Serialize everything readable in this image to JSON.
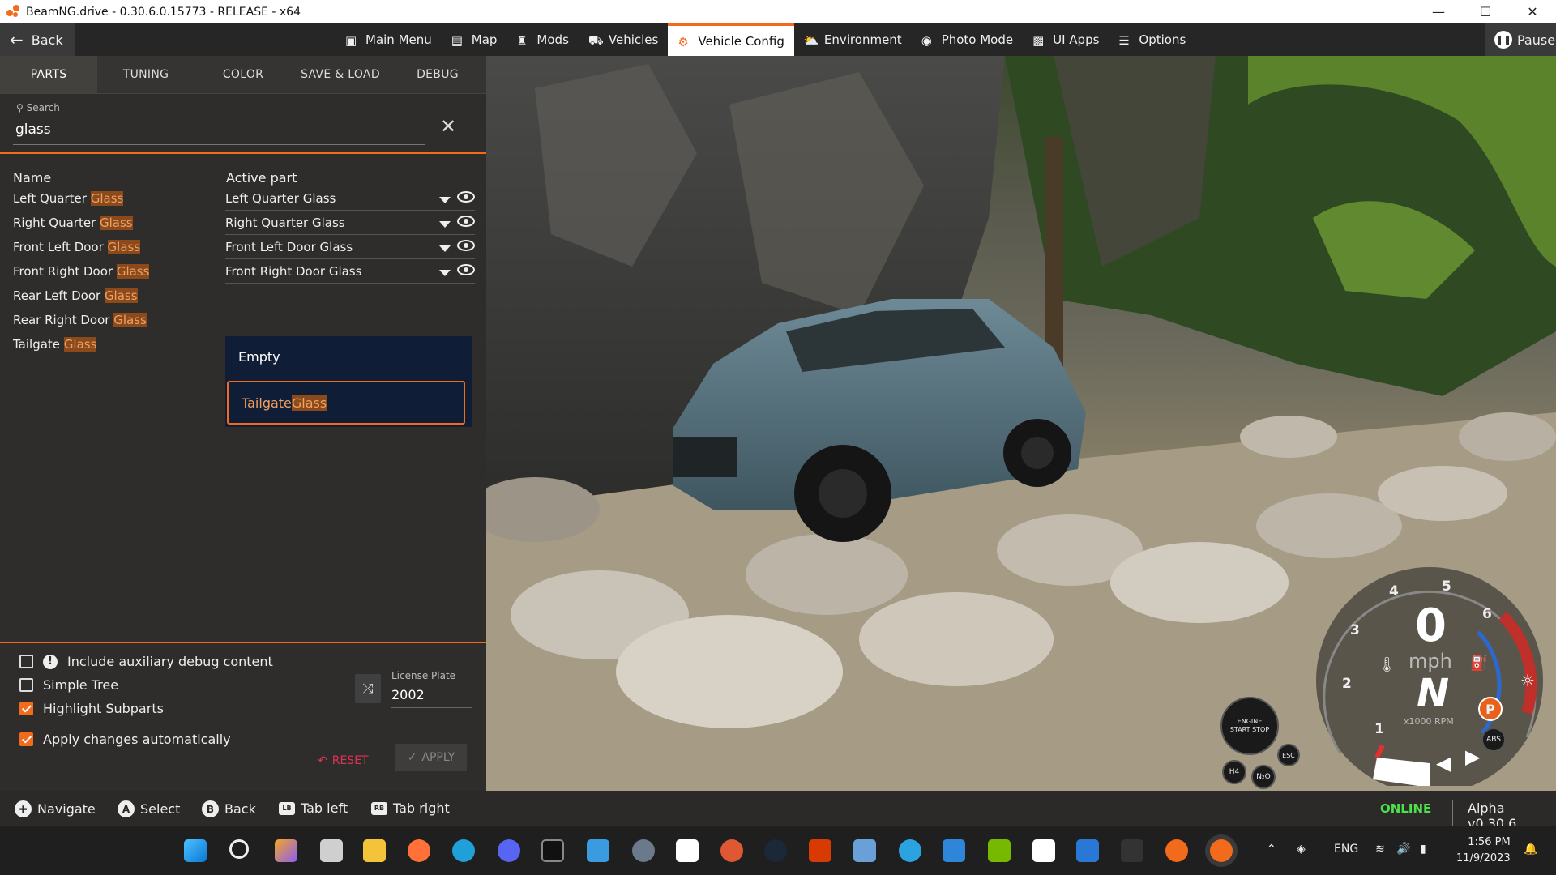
{
  "window": {
    "title": "BeamNG.drive - 0.30.6.0.15773 - RELEASE - x64"
  },
  "topbar": {
    "back_label": "Back",
    "menu": [
      {
        "label": "Main Menu",
        "icon": "main-menu-icon"
      },
      {
        "label": "Map",
        "icon": "map-icon"
      },
      {
        "label": "Mods",
        "icon": "puzzle-icon"
      },
      {
        "label": "Vehicles",
        "icon": "car-icon"
      },
      {
        "label": "Vehicle Config",
        "icon": "engine-icon",
        "active": true
      },
      {
        "label": "Environment",
        "icon": "weather-icon"
      },
      {
        "label": "Photo Mode",
        "icon": "camera-icon"
      },
      {
        "label": "UI Apps",
        "icon": "ui-apps-icon"
      },
      {
        "label": "Options",
        "icon": "sliders-icon"
      }
    ],
    "pause_label": "Pause"
  },
  "panel": {
    "tabs": [
      "PARTS",
      "TUNING",
      "COLOR",
      "SAVE & LOAD",
      "DEBUG"
    ],
    "search": {
      "label": "Search",
      "value": "glass"
    },
    "table": {
      "col_name": "Name",
      "col_active": "Active part"
    },
    "rows": [
      {
        "prefix": "Left Quarter ",
        "match": "Glass",
        "active": "Left Quarter Glass"
      },
      {
        "prefix": "Right Quarter ",
        "match": "Glass",
        "active": "Right Quarter Glass"
      },
      {
        "prefix": "Front Left Door ",
        "match": "Glass",
        "active": "Front Left Door Glass"
      },
      {
        "prefix": "Front Right Door ",
        "match": "Glass",
        "active": "Front Right Door Glass"
      },
      {
        "prefix": "Rear Left Door ",
        "match": "Glass",
        "active": ""
      },
      {
        "prefix": "Rear Right Door ",
        "match": "Glass",
        "active": ""
      },
      {
        "prefix": "Tailgate ",
        "match": "Glass",
        "active": ""
      }
    ],
    "dropdown": {
      "empty": "Empty",
      "selected_prefix": "Tailgate",
      "selected_match": "Glass"
    },
    "options": {
      "aux_debug": "Include auxiliary debug content",
      "simple_tree": "Simple Tree",
      "highlight": "Highlight Subparts",
      "auto_apply": "Apply changes automatically"
    },
    "plate": {
      "label": "License Plate",
      "value": "2002"
    },
    "reset": "RESET",
    "apply": "APPLY"
  },
  "hints": [
    {
      "btn": "",
      "label": "Navigate"
    },
    {
      "btn": "A",
      "label": "Select"
    },
    {
      "btn": "B",
      "label": "Back"
    },
    {
      "btn": "LB",
      "label": "Tab left"
    },
    {
      "btn": "RB",
      "label": "Tab right"
    }
  ],
  "status": {
    "online": "ONLINE",
    "version": "Alpha v0.30.6"
  },
  "hud": {
    "speed": "0",
    "unit": "mph",
    "gear": "N",
    "rpm_label": "x1000 RPM",
    "ticks": [
      "1",
      "2",
      "3",
      "4",
      "5",
      "6"
    ],
    "engine": "ENGINE START STOP",
    "esc": "ESC",
    "h4": "H4",
    "n2o": "N₂O",
    "abs": "ABS",
    "park": "P"
  },
  "tray": {
    "lang": "ENG",
    "time": "1:56 PM",
    "date": "11/9/2023"
  },
  "colors": {
    "accent": "#f26a1b",
    "online": "#4ce04c",
    "dropdown_bg": "#0f1d36"
  }
}
